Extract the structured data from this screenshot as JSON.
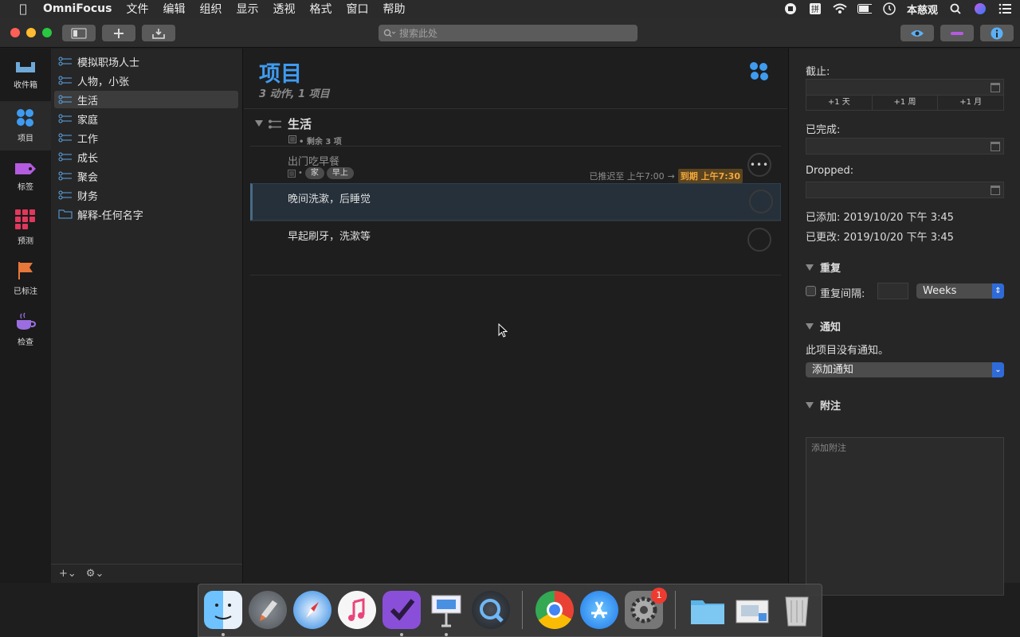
{
  "menubar": {
    "app_name": "OmniFocus",
    "menus": [
      "文件",
      "编辑",
      "组织",
      "显示",
      "透视",
      "格式",
      "窗口",
      "帮助"
    ],
    "user": "本慈观"
  },
  "toolbar": {
    "search_placeholder": "搜索此处"
  },
  "perspectives": [
    {
      "label": "收件箱",
      "icon": "inbox-icon"
    },
    {
      "label": "项目",
      "icon": "projects-icon"
    },
    {
      "label": "标签",
      "icon": "tag-icon"
    },
    {
      "label": "预测",
      "icon": "forecast-icon"
    },
    {
      "label": "已标注",
      "icon": "flag-icon"
    },
    {
      "label": "检查",
      "icon": "review-icon"
    }
  ],
  "sidebar": {
    "items": [
      {
        "label": "模拟职场人士",
        "kind": "project"
      },
      {
        "label": "人物，小张",
        "kind": "project"
      },
      {
        "label": "生活",
        "kind": "project"
      },
      {
        "label": "家庭",
        "kind": "project"
      },
      {
        "label": "工作",
        "kind": "project"
      },
      {
        "label": "成长",
        "kind": "project"
      },
      {
        "label": "聚会",
        "kind": "project"
      },
      {
        "label": "财务",
        "kind": "project"
      },
      {
        "label": "解释-任何名字",
        "kind": "folder"
      }
    ]
  },
  "content": {
    "title": "项目",
    "subtitle": "3 动作, 1 项目",
    "group": {
      "title": "生活",
      "remaining": "• 剩余 3 项"
    },
    "tasks": [
      {
        "name": "出门吃早餐",
        "tags": [
          "家",
          "早上"
        ],
        "deferred_text": "已推迟至 上午7:00",
        "arrow": "→",
        "due_text": "到期 上午7:30"
      },
      {
        "name": "晚间洗漱，后睡觉"
      },
      {
        "name": "早起刷牙，洗漱等"
      }
    ]
  },
  "inspector": {
    "due_label": "截止:",
    "quick_buttons": [
      "+1 天",
      "+1 周",
      "+1 月"
    ],
    "completed_label": "已完成:",
    "dropped_label": "Dropped:",
    "added": "已添加: 2019/10/20 下午 3:45",
    "modified": "已更改: 2019/10/20 下午 3:45",
    "repeat_section": "重复",
    "repeat_interval_label": "重复间隔:",
    "repeat_unit": "Weeks",
    "notify_section": "通知",
    "no_notify_text": "此项目没有通知。",
    "add_notify": "添加通知",
    "note_section": "附注",
    "note_placeholder": "添加附注"
  },
  "dock": {
    "apps": [
      "Finder",
      "Launchpad",
      "Safari",
      "iTunes",
      "OmniFocus",
      "Keynote",
      "QuickTime Player",
      "Chrome",
      "App Store",
      "System Preferences",
      "Downloads",
      "Preview",
      "Trash"
    ],
    "system_prefs_badge": "1"
  },
  "colors": {
    "accent_blue": "#3f9bf0",
    "due_orange": "#f3a73c"
  }
}
